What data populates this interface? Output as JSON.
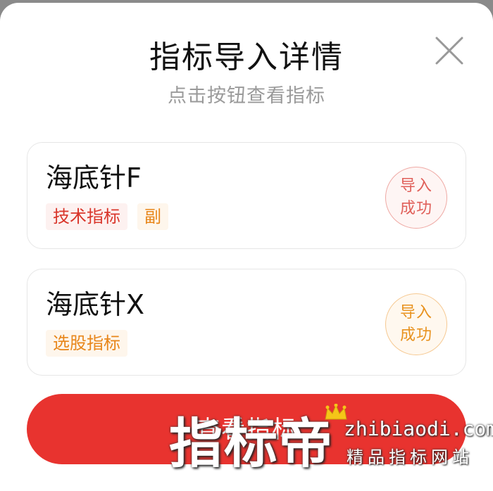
{
  "dialog": {
    "title": "指标导入详情",
    "subtitle": "点击按钮查看指标"
  },
  "indicators": [
    {
      "name": "海底针F",
      "tags": [
        "技术指标",
        "副"
      ],
      "status": [
        "导入",
        "成功"
      ]
    },
    {
      "name": "海底针X",
      "tags": [
        "选股指标"
      ],
      "status": [
        "导入",
        "成功"
      ]
    }
  ],
  "actions": {
    "view_label": "查看指标"
  },
  "watermark": {
    "brand": "指标帝",
    "url": "zhibiaodi.com",
    "slogan": "精品指标网站"
  },
  "colors": {
    "accent_red": "#e8332f",
    "tag_red": "#d9362b",
    "tag_orange": "#e8861a"
  }
}
